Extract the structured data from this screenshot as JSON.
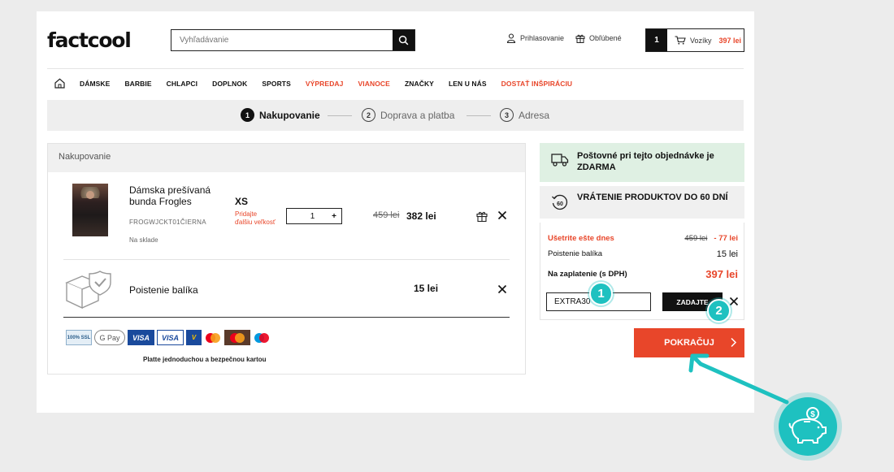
{
  "brand": {
    "logo": "factcool"
  },
  "search": {
    "placeholder": "Vyhľadávanie"
  },
  "header": {
    "login": "Prihlasovanie",
    "favorites": "Obľúbené",
    "cart_count": "1",
    "cart_label": "Vozíky",
    "cart_total": "397 lei"
  },
  "nav": {
    "items": [
      "DÁMSKE",
      "BARBIE",
      "CHLAPCI",
      "DOPLNOK",
      "SPORTS",
      "VÝPREDAJ",
      "VIANOCE",
      "ZNAČKY",
      "LEN U NÁS",
      "DOSTAŤ INŠPIRÁCIU"
    ],
    "red_items": [
      "VÝPREDAJ",
      "VIANOCE",
      "DOSTAŤ INŠPIRÁCIU"
    ]
  },
  "steps": [
    {
      "num": "1",
      "label": "Nakupovanie",
      "active": true
    },
    {
      "num": "2",
      "label": "Doprava a platba",
      "active": false
    },
    {
      "num": "3",
      "label": "Adresa",
      "active": false
    }
  ],
  "cart": {
    "title": "Nakupovanie",
    "product": {
      "name": "Dámska prešívaná bunda Frogles",
      "code": "FROGWJCKT01ČIERNA",
      "stock": "Na sklade",
      "size": "XS",
      "size_add": "Pridajte ďalšiu veľkosť",
      "qty": "1",
      "old_price": "459 lei",
      "price": "382 lei"
    },
    "package": {
      "name": "Poistenie balíka",
      "price": "15 lei"
    },
    "pay_text": "Platte jednoduchou a bezpečnou kartou",
    "payment_icons": [
      "ssl-icon",
      "gpay-icon",
      "visa-icon",
      "visa-electron-icon",
      "vpay-icon",
      "mastercard-icon",
      "maestro-icon"
    ]
  },
  "sidebar": {
    "free_shipping": "Poštovné pri tejto objednávke je ZDARMA",
    "returns": "VRÁTENIE PRODUKTOV DO 60 DNÍ",
    "returns_badge": "60",
    "save_label": "Ušetrite ešte dnes",
    "save_old": "459 lei",
    "save_amount": "- 77 lei",
    "insurance_label": "Poistenie balíka",
    "insurance_value": "15 lei",
    "pay_label": "Na zaplatenie (s DPH)",
    "pay_value": "397 lei",
    "coupon_value": "EXTRA30",
    "apply_label": "ZADAJTE",
    "continue_label": "POKRAČUJ"
  },
  "annotations": {
    "step1": "1",
    "step2": "2"
  },
  "colors": {
    "accent": "#e8462a",
    "teal": "#1ec1c0",
    "green_info": "#dff0e3"
  }
}
